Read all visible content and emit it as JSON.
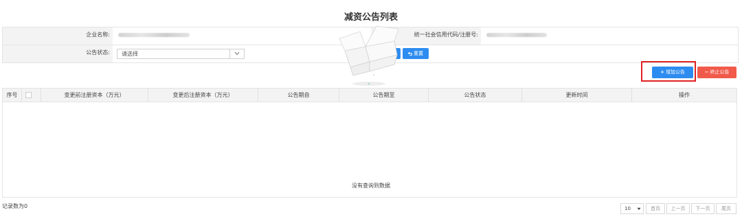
{
  "page": {
    "title": "减资公告列表"
  },
  "form": {
    "company_name_label": "企业名称:",
    "credit_code_label": "统一社会信用代码/注册号:",
    "status_label": "公告状态:",
    "status_placeholder": "请选择",
    "search_label": "查询",
    "reset_label": "重置"
  },
  "actions": {
    "add_label": "增加公告",
    "stop_label": "终止公告"
  },
  "table": {
    "columns": [
      "序号",
      "",
      "变更前注册资本（万元）",
      "变更后注册资本（万元）",
      "公告期自",
      "公告期至",
      "公告状态",
      "更新时间",
      "操作"
    ],
    "empty_text": "没有查询到数据"
  },
  "footer": {
    "record_count": "记录数为0",
    "page_size": "10",
    "first": "首页",
    "prev": "上一页",
    "next": "下一页",
    "last": "尾页"
  },
  "colors": {
    "primary": "#2d8cf0",
    "danger": "#f15a4a",
    "highlight": "#e02020"
  }
}
